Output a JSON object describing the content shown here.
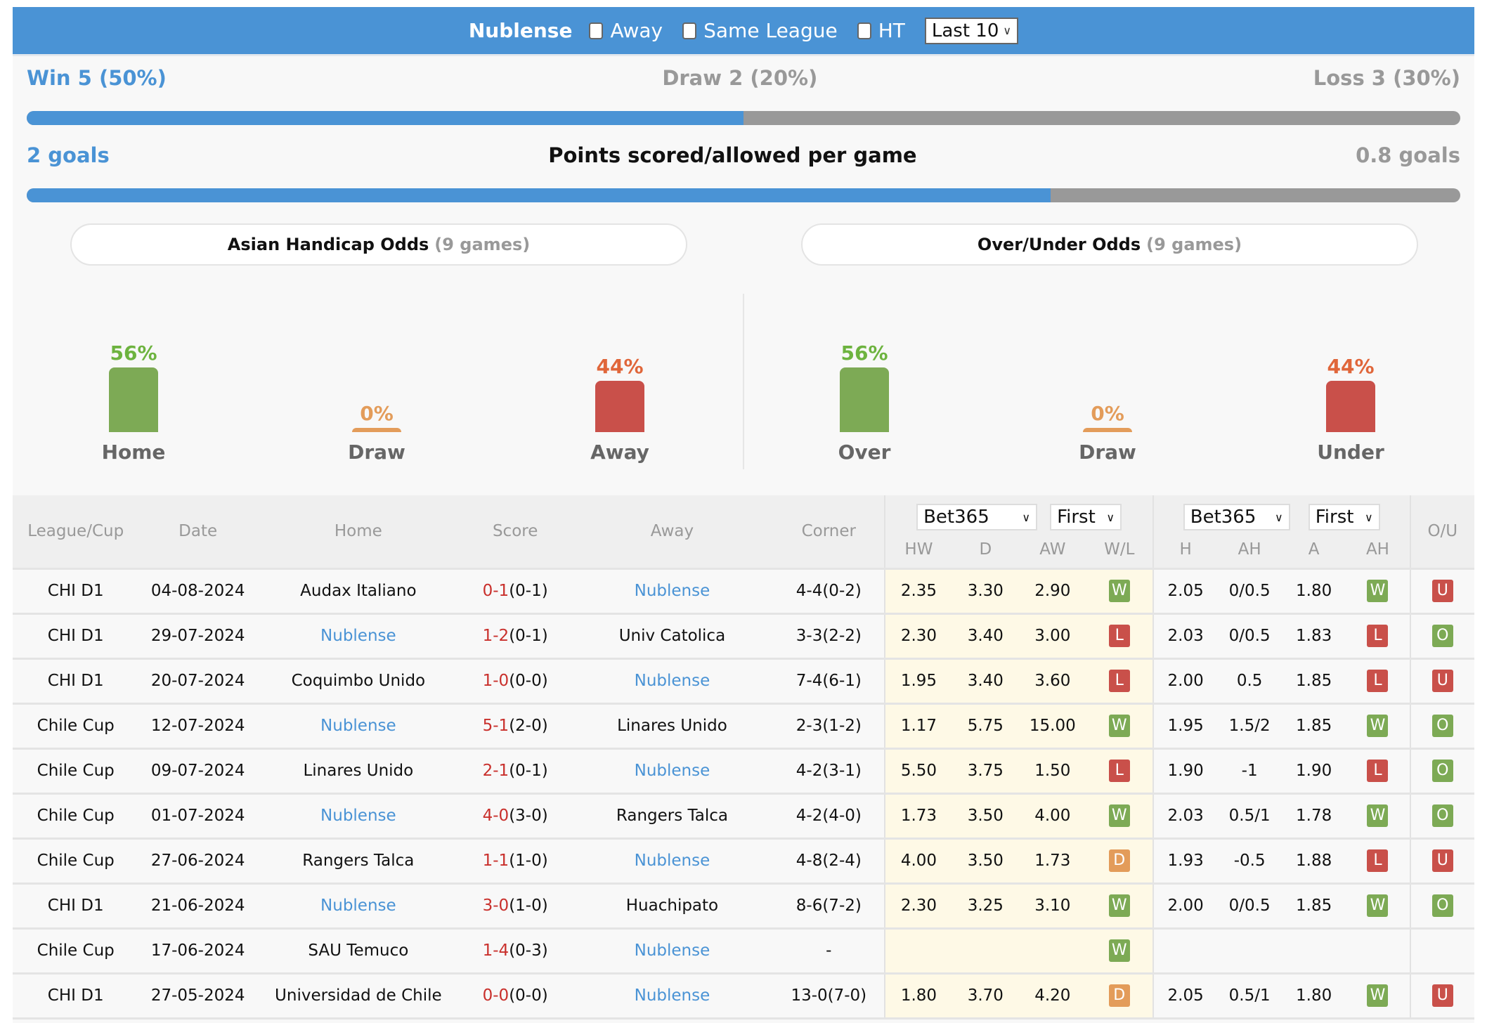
{
  "header": {
    "team": "Nublense",
    "filters": [
      {
        "label": "Away",
        "checked": false
      },
      {
        "label": "Same League",
        "checked": false
      },
      {
        "label": "HT",
        "checked": false
      }
    ],
    "range_select": "Last 10"
  },
  "summary": {
    "win_label": "Win 5 (50%)",
    "draw_label": "Draw 2 (20%)",
    "loss_label": "Loss 3 (30%)",
    "win_fraction": 0.5,
    "goals_for_label": "2 goals",
    "goals_title": "Points scored/allowed per game",
    "goals_against_label": "0.8 goals",
    "goals_for_fraction": 0.714
  },
  "chart_data": [
    {
      "type": "bar",
      "title": "Asian Handicap Odds",
      "subtitle": "(9 games)",
      "categories": [
        "Home",
        "Draw",
        "Away"
      ],
      "values": [
        56,
        0,
        44
      ],
      "labels": [
        "56%",
        "0%",
        "44%"
      ],
      "colors": [
        "#7daa55",
        "#e39c5a",
        "#c9504a"
      ],
      "label_colors": [
        "#6db33f",
        "#e39c5a",
        "#e0663a"
      ],
      "ylim": [
        0,
        100
      ]
    },
    {
      "type": "bar",
      "title": "Over/Under Odds",
      "subtitle": "(9 games)",
      "categories": [
        "Over",
        "Draw",
        "Under"
      ],
      "values": [
        56,
        0,
        44
      ],
      "labels": [
        "56%",
        "0%",
        "44%"
      ],
      "colors": [
        "#7daa55",
        "#e39c5a",
        "#c9504a"
      ],
      "label_colors": [
        "#6db33f",
        "#e39c5a",
        "#e0663a"
      ],
      "ylim": [
        0,
        100
      ]
    }
  ],
  "table": {
    "headers": {
      "league": "League/Cup",
      "date": "Date",
      "home": "Home",
      "score": "Score",
      "away": "Away",
      "corner": "Corner",
      "odds1_company": "Bet365",
      "odds1_type": "First",
      "odds2_company": "Bet365",
      "odds2_type": "First",
      "hw": "HW",
      "d": "D",
      "aw": "AW",
      "wl": "W/L",
      "h": "H",
      "ah": "AH",
      "a": "A",
      "ah_res": "AH",
      "ou": "O/U"
    },
    "rows": [
      {
        "league": "CHI D1",
        "date": "04-08-2024",
        "home": "Audax Italiano",
        "home_hl": false,
        "ft": "0-1",
        "ht": "(0-1)",
        "away": "Nublense",
        "away_hl": true,
        "corner": "4-4(0-2)",
        "hw": "2.35",
        "d": "3.30",
        "aw": "2.90",
        "wl": "W",
        "h": "2.05",
        "ah": "0/0.5",
        "a": "1.80",
        "ahr": "W",
        "ou": "U"
      },
      {
        "league": "CHI D1",
        "date": "29-07-2024",
        "home": "Nublense",
        "home_hl": true,
        "ft": "1-2",
        "ht": "(0-1)",
        "away": "Univ Catolica",
        "away_hl": false,
        "corner": "3-3(2-2)",
        "hw": "2.30",
        "d": "3.40",
        "aw": "3.00",
        "wl": "L",
        "h": "2.03",
        "ah": "0/0.5",
        "a": "1.83",
        "ahr": "L",
        "ou": "O"
      },
      {
        "league": "CHI D1",
        "date": "20-07-2024",
        "home": "Coquimbo Unido",
        "home_hl": false,
        "ft": "1-0",
        "ht": "(0-0)",
        "away": "Nublense",
        "away_hl": true,
        "corner": "7-4(6-1)",
        "hw": "1.95",
        "d": "3.40",
        "aw": "3.60",
        "wl": "L",
        "h": "2.00",
        "ah": "0.5",
        "a": "1.85",
        "ahr": "L",
        "ou": "U"
      },
      {
        "league": "Chile Cup",
        "date": "12-07-2024",
        "home": "Nublense",
        "home_hl": true,
        "ft": "5-1",
        "ht": "(2-0)",
        "away": "Linares Unido",
        "away_hl": false,
        "corner": "2-3(1-2)",
        "hw": "1.17",
        "d": "5.75",
        "aw": "15.00",
        "wl": "W",
        "h": "1.95",
        "ah": "1.5/2",
        "a": "1.85",
        "ahr": "W",
        "ou": "O"
      },
      {
        "league": "Chile Cup",
        "date": "09-07-2024",
        "home": "Linares Unido",
        "home_hl": false,
        "ft": "2-1",
        "ht": "(0-1)",
        "away": "Nublense",
        "away_hl": true,
        "corner": "4-2(3-1)",
        "hw": "5.50",
        "d": "3.75",
        "aw": "1.50",
        "wl": "L",
        "h": "1.90",
        "ah": "-1",
        "a": "1.90",
        "ahr": "L",
        "ou": "O"
      },
      {
        "league": "Chile Cup",
        "date": "01-07-2024",
        "home": "Nublense",
        "home_hl": true,
        "ft": "4-0",
        "ht": "(3-0)",
        "away": "Rangers Talca",
        "away_hl": false,
        "corner": "4-2(4-0)",
        "hw": "1.73",
        "d": "3.50",
        "aw": "4.00",
        "wl": "W",
        "h": "2.03",
        "ah": "0.5/1",
        "a": "1.78",
        "ahr": "W",
        "ou": "O"
      },
      {
        "league": "Chile Cup",
        "date": "27-06-2024",
        "home": "Rangers Talca",
        "home_hl": false,
        "ft": "1-1",
        "ht": "(1-0)",
        "away": "Nublense",
        "away_hl": true,
        "corner": "4-8(2-4)",
        "hw": "4.00",
        "d": "3.50",
        "aw": "1.73",
        "wl": "D",
        "h": "1.93",
        "ah": "-0.5",
        "a": "1.88",
        "ahr": "L",
        "ou": "U"
      },
      {
        "league": "CHI D1",
        "date": "21-06-2024",
        "home": "Nublense",
        "home_hl": true,
        "ft": "3-0",
        "ht": "(1-0)",
        "away": "Huachipato",
        "away_hl": false,
        "corner": "8-6(7-2)",
        "hw": "2.30",
        "d": "3.25",
        "aw": "3.10",
        "wl": "W",
        "h": "2.00",
        "ah": "0/0.5",
        "a": "1.85",
        "ahr": "W",
        "ou": "O"
      },
      {
        "league": "Chile Cup",
        "date": "17-06-2024",
        "home": "SAU Temuco",
        "home_hl": false,
        "ft": "1-4",
        "ht": "(0-3)",
        "away": "Nublense",
        "away_hl": true,
        "corner": "-",
        "hw": "",
        "d": "",
        "aw": "",
        "wl": "W",
        "h": "",
        "ah": "",
        "a": "",
        "ahr": "",
        "ou": ""
      },
      {
        "league": "CHI D1",
        "date": "27-05-2024",
        "home": "Universidad de Chile",
        "home_hl": false,
        "ft": "0-0",
        "ht": "(0-0)",
        "away": "Nublense",
        "away_hl": true,
        "corner": "13-0(7-0)",
        "hw": "1.80",
        "d": "3.70",
        "aw": "4.20",
        "wl": "D",
        "h": "2.05",
        "ah": "0.5/1",
        "a": "1.80",
        "ahr": "W",
        "ou": "U"
      }
    ]
  }
}
